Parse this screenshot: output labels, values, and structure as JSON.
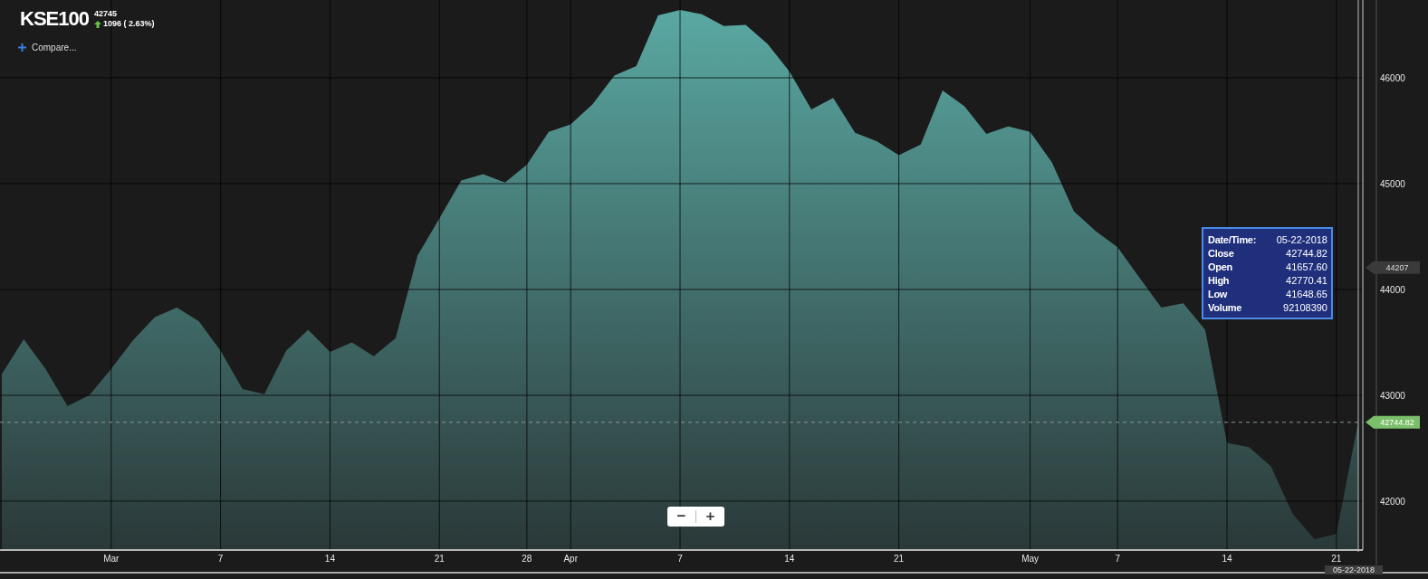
{
  "header": {
    "symbol": "KSE100",
    "last": "42745",
    "change": "1096 ( 2.63%)",
    "compare": "Compare..."
  },
  "chart": {
    "chart_data": {
      "type": "area",
      "categories": [
        null,
        null,
        null,
        null,
        null,
        "Mar",
        null,
        null,
        null,
        null,
        "7",
        null,
        null,
        null,
        null,
        "14",
        null,
        null,
        null,
        null,
        "21",
        null,
        null,
        null,
        "28",
        null,
        "Apr",
        null,
        null,
        null,
        null,
        "7",
        null,
        null,
        null,
        null,
        "14",
        null,
        null,
        null,
        null,
        "21",
        null,
        null,
        null,
        null,
        null,
        "May",
        null,
        null,
        null,
        "7",
        null,
        null,
        null,
        null,
        "14",
        null,
        null,
        null,
        null,
        "21",
        null
      ],
      "series": [
        {
          "color": "#5aa8a2",
          "values": [
            43200,
            43530,
            43250,
            42900,
            43000,
            43250,
            43520,
            43740,
            43830,
            43700,
            43420,
            43060,
            43010,
            43420,
            43620,
            43410,
            43500,
            43370,
            43540,
            44320,
            44670,
            45030,
            45090,
            45010,
            45180,
            45490,
            45560,
            45750,
            46020,
            46110,
            46590,
            46640,
            46600,
            46490,
            46500,
            46320,
            46060,
            45700,
            45810,
            45480,
            45400,
            45270,
            45370,
            45880,
            45730,
            45470,
            45540,
            45490,
            45200,
            44740,
            44550,
            44400,
            44110,
            43830,
            43870,
            43620,
            42550,
            42510,
            42330,
            41880,
            41640,
            41690,
            42750
          ]
        }
      ],
      "ylim": [
        41538,
        46735
      ],
      "yticks": [
        42000,
        43000,
        44000,
        45000,
        46000
      ],
      "grid": true,
      "ref_lines": [
        {
          "axis": "y",
          "value": 42744.82
        }
      ]
    }
  },
  "price_labels": [
    {
      "kind": "crosshair",
      "text": "44207"
    },
    {
      "kind": "last",
      "text": "42744.82"
    }
  ],
  "crosshair_date": "05-22-2018",
  "tooltip": {
    "rows": [
      {
        "label": "Date/Time:",
        "value": "05-22-2018"
      },
      {
        "label": "Close",
        "value": "42744.82"
      },
      {
        "label": "Open",
        "value": "41657.60"
      },
      {
        "label": "High",
        "value": "42770.41"
      },
      {
        "label": "Low",
        "value": "41648.65"
      },
      {
        "label": "Volume",
        "value": "92108390"
      }
    ]
  },
  "zoom": {
    "buttons": [
      "−",
      "+"
    ]
  }
}
